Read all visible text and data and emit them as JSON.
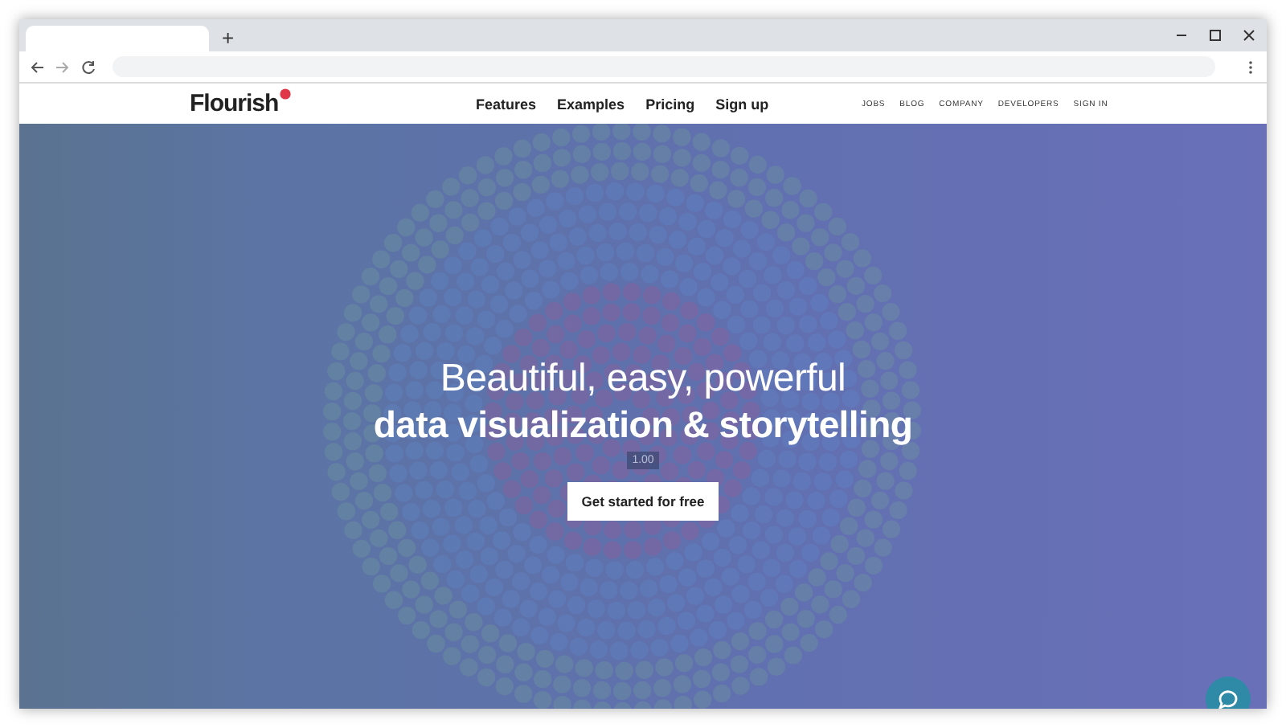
{
  "site": {
    "logo": "Flourish",
    "main_nav": [
      {
        "label": "Features"
      },
      {
        "label": "Examples"
      },
      {
        "label": "Pricing"
      },
      {
        "label": "Sign up"
      }
    ],
    "secondary_nav": [
      {
        "label": "JOBS"
      },
      {
        "label": "BLOG"
      },
      {
        "label": "COMPANY"
      },
      {
        "label": "DEVELOPERS"
      },
      {
        "label": "SIGN IN"
      }
    ]
  },
  "browser": {
    "new_tab": "+"
  },
  "hero": {
    "headline_light": "Beautiful, easy, powerful",
    "headline_bold": "data visualization & storytelling",
    "scale_label": "1.00",
    "cta": "Get started for free"
  }
}
